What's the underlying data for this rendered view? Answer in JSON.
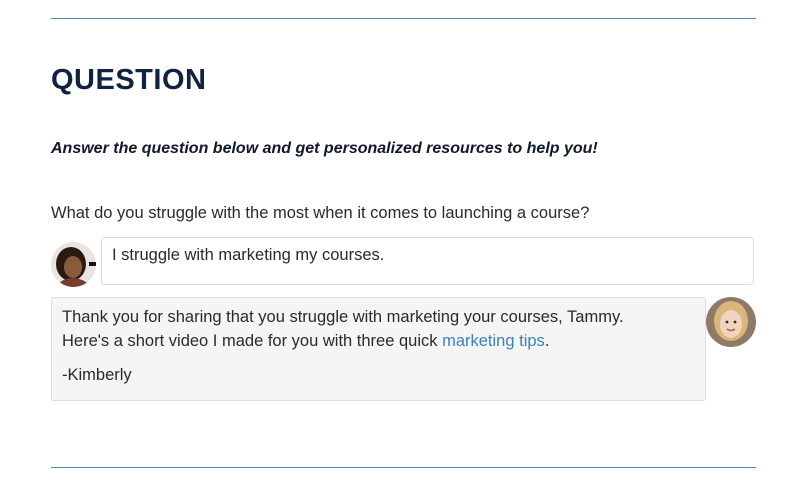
{
  "section": {
    "heading": "QUESTION",
    "subtitle": "Answer the question below and get personalized resources to help you!"
  },
  "question": {
    "prompt": "What do you struggle with the most when it comes to launching a course?"
  },
  "user": {
    "avatar_icon": "user-avatar-icon",
    "answer": "I struggle with marketing my courses."
  },
  "response": {
    "avatar_icon": "author-avatar-icon",
    "line1": "Thank you for sharing that you struggle with marketing your courses, Tammy.",
    "line2_prefix": "Here's a short video I made for you with three quick ",
    "link_text": "marketing tips",
    "line2_suffix": ".",
    "signature": "-Kimberly"
  },
  "colors": {
    "rule": "#4a8aa6",
    "heading": "#0f2340",
    "link": "#3b82b5",
    "response_bg": "#f5f5f5"
  }
}
